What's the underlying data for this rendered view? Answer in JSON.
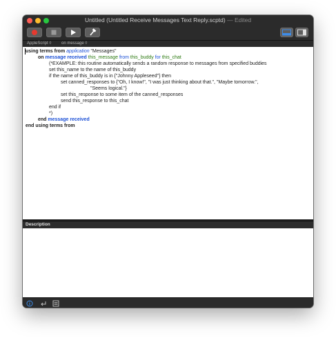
{
  "window": {
    "title": "Untitled (Untitled Receive Messages Text Reply.scptd)",
    "edited": " — Edited"
  },
  "toolbar": {
    "record_icon": "record-icon",
    "stop_icon": "stop-icon",
    "run_icon": "run-icon",
    "compile_icon": "hammer-icon",
    "view_icons": [
      "log-view-icon",
      "sidebar-icon"
    ]
  },
  "navbar": {
    "language": "AppleScript ◊",
    "handler": "on message ◊"
  },
  "script": {
    "l1_kw": "using terms from",
    "l1_app": "application",
    "l1_name": " \"Messages\"",
    "l2_on": "on",
    "l2_handler": "message received",
    "l2_p1": "this_message",
    "l2_from": "from",
    "l2_p2": "this_buddy",
    "l2_for": "for",
    "l2_p3": "this_chat",
    "l3": "(*EXAMPLE: this routine automatically sends a random response to messages from specified buddies",
    "l4": "set this_name to the name of this_buddy",
    "l5": "if the name of this_buddy is in {\"Johnny Appleseed\"} then",
    "l6": "set canned_responses to {\"Oh, I know!\", \"I was just thinking about that.\", \"Maybe tomorrow.\",",
    "l7": "\"Seems logical.\"}",
    "l8": "set this_response to some item of the canned_responses",
    "l9": "send this_response to this_chat",
    "l10": "end if",
    "l11": "*)",
    "l12_end": "end",
    "l12_handler": "message received",
    "l13": "end using terms from"
  },
  "description": {
    "header": "Description"
  },
  "bottombar": {
    "icons": [
      "info-icon",
      "return-icon",
      "list-icon"
    ]
  },
  "colors": {
    "keyword_blue": "#1a4fd6",
    "variable_green": "#2d7a12",
    "record_red": "#e5392f"
  }
}
